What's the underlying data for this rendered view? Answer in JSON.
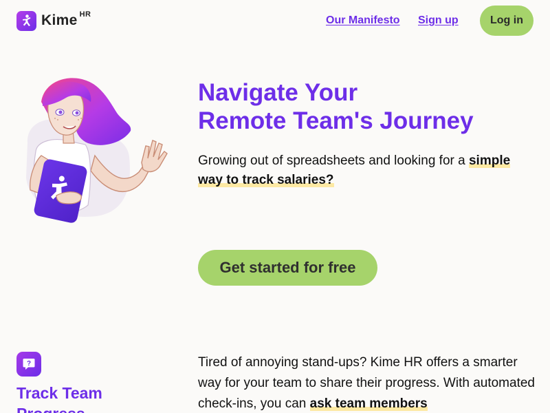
{
  "header": {
    "logo_text": "Kime",
    "logo_superscript": "HR",
    "nav": {
      "manifesto": "Our Manifesto",
      "signup": "Sign up",
      "login": "Log in"
    }
  },
  "hero": {
    "title_line1": "Navigate Your",
    "title_line2": "Remote Team's Journey",
    "description_prefix": "Growing out of spreadsheets and looking for a ",
    "description_highlight": "simple way to track salaries?",
    "cta": "Get started for free"
  },
  "feature": {
    "icon_glyph": "?",
    "title": "Track Team Progress",
    "description_prefix": "Tired of annoying stand-ups? Kime HR offers a smarter way for your team to share their progress. With automated check-ins, you can ",
    "description_highlight": "ask team members"
  },
  "colors": {
    "brand_purple": "#6d2ee8",
    "accent_green": "#a6d36b",
    "highlight_yellow": "#fde9a3",
    "background": "#fbfaf8"
  },
  "icons": {
    "logo": "kime-person-icon",
    "feature": "question-bubble-icon",
    "hero": "waving-woman-illustration"
  }
}
